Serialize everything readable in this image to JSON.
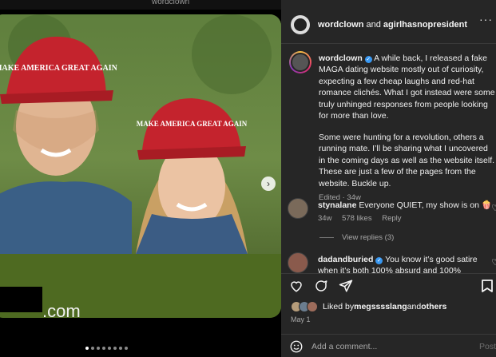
{
  "topbar": {
    "handle": "wordclown"
  },
  "media": {
    "url_suffix": ".com",
    "carousel_dots": 8,
    "active_dot": 0,
    "hat_text": "MAKE AMERICA GREAT AGAIN"
  },
  "header": {
    "author": "wordclown",
    "joiner": " and ",
    "collaborator": "agirlhasnopresident",
    "more": "···"
  },
  "caption": {
    "username": "wordclown",
    "p1": " A while back, I released a fake MAGA dating website mostly out of curiosity, expecting a few cheap laughs and red-hat romance clichés. What I got instead were some truly unhinged responses from people looking for more than love.",
    "p2": "Some were hunting for a revolution, others a running mate. I’ll be sharing what I uncovered in the coming days as well as the website itself. These are just a few of the pages from the website. Buckle up.",
    "meta": "Edited · 34w"
  },
  "comments": [
    {
      "username": "stynalane",
      "text": " Everyone QUIET, my show is on 🍿",
      "age": "34w",
      "likes": "578 likes",
      "reply": "Reply"
    },
    {
      "username": "dadandburied",
      "text": " You know it’s good satire when it’s both 100% absurd and 100%"
    }
  ],
  "view_replies": "View replies (3)",
  "liked_by": {
    "prefix": "Liked by ",
    "user": "megsssslang",
    "joiner": " and ",
    "others": "others"
  },
  "date": "May 1",
  "add_comment": {
    "placeholder": "Add a comment...",
    "post_label": "Post"
  }
}
